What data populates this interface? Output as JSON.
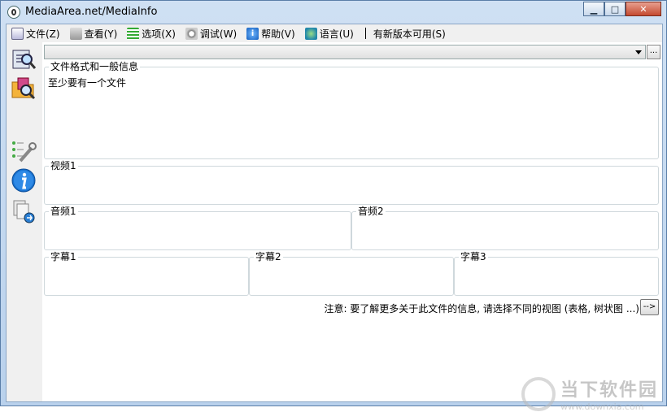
{
  "window": {
    "title": "MediaArea.net/MediaInfo"
  },
  "title_buttons": {
    "minimize": "▁",
    "maximize": "□",
    "close": "✕"
  },
  "menu": {
    "items": [
      {
        "label": "文件(Z)",
        "icon": "file-icon"
      },
      {
        "label": "查看(Y)",
        "icon": "view-icon"
      },
      {
        "label": "选项(X)",
        "icon": "options-icon"
      },
      {
        "label": "调试(W)",
        "icon": "debug-icon"
      },
      {
        "label": "帮助(V)",
        "icon": "help-icon"
      },
      {
        "label": "语言(U)",
        "icon": "language-icon"
      }
    ],
    "update_label": "有新版本可用(S)"
  },
  "toolbar": {
    "ellipsis": "..."
  },
  "sidebar": {
    "icons": [
      "open-file-icon",
      "open-folder-icon",
      "preferences-icon",
      "info-icon",
      "export-icon"
    ]
  },
  "sections": {
    "general": {
      "legend": "文件格式和一般信息",
      "text": "至少要有一个文件"
    },
    "video1": {
      "legend": "视频1"
    },
    "audio1": {
      "legend": "音频1"
    },
    "audio2": {
      "legend": "音频2"
    },
    "subtitle1": {
      "legend": "字幕1"
    },
    "subtitle2": {
      "legend": "字幕2"
    },
    "subtitle3": {
      "legend": "字幕3"
    }
  },
  "footer": {
    "note": "注意: 要了解更多关于此文件的信息, 请选择不同的视图 (表格, 树状图 ...)",
    "arrow_button": "-->"
  },
  "watermark": {
    "text": "当下软件园",
    "url": "www.downxia.com"
  }
}
